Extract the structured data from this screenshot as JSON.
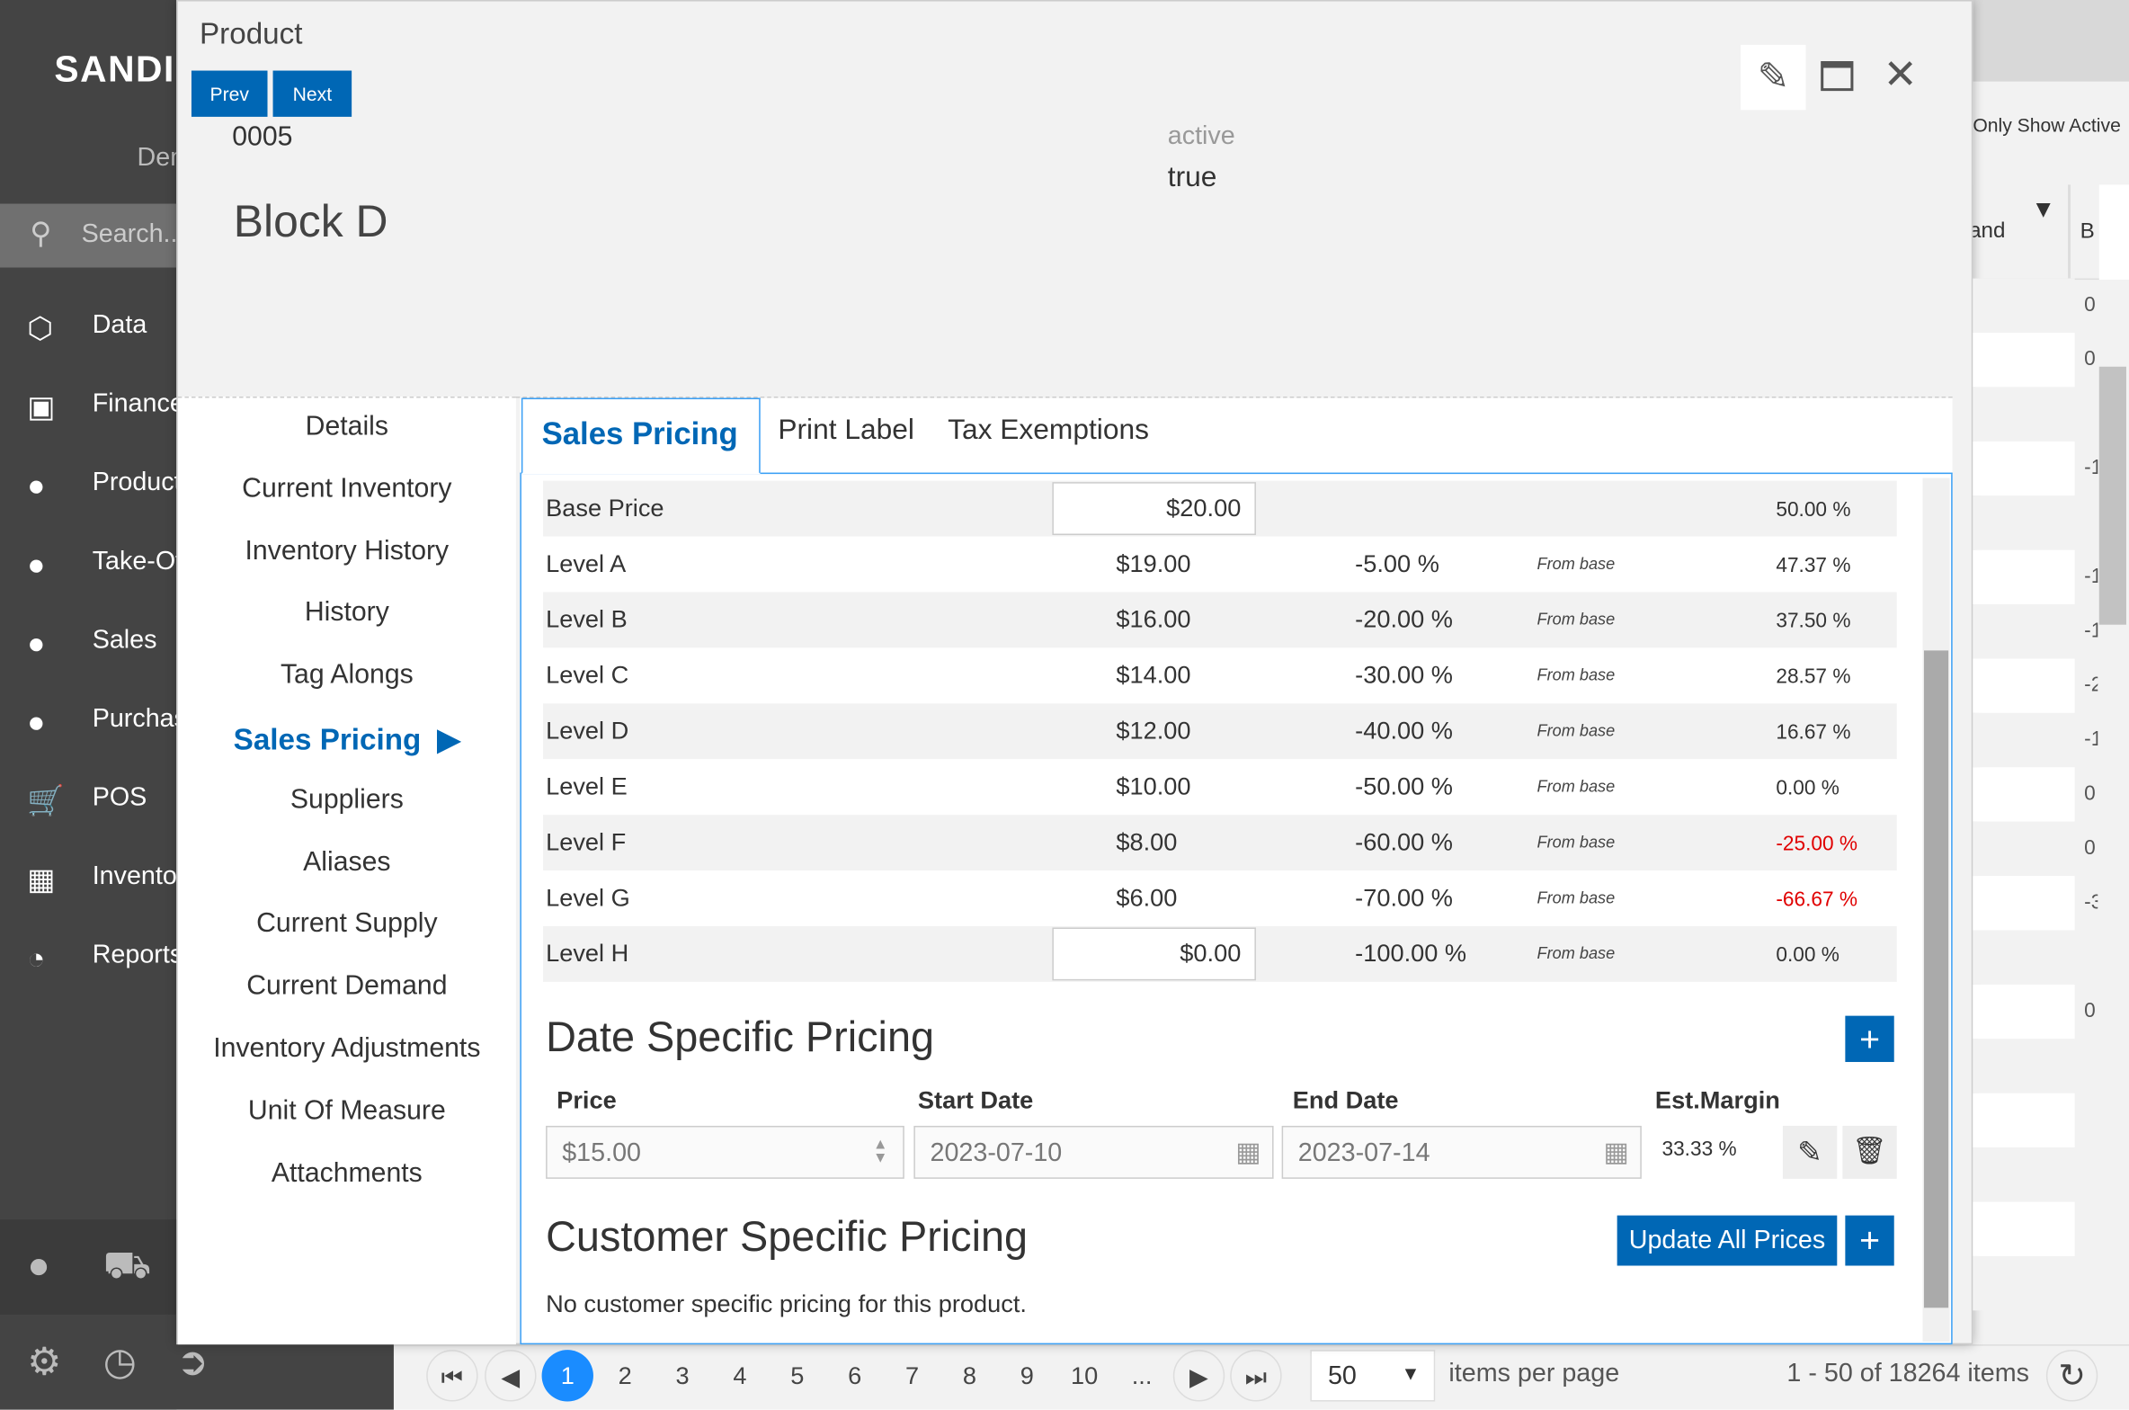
{
  "app": {
    "logo": "SANDI",
    "demo": "Demo",
    "search_placeholder": "Search...",
    "nav": [
      {
        "label": "Data",
        "icon": "cube-icon"
      },
      {
        "label": "Finance",
        "icon": "money-icon"
      },
      {
        "label": "Products",
        "icon": "users-icon"
      },
      {
        "label": "Take-Offs",
        "icon": "users-icon"
      },
      {
        "label": "Sales",
        "icon": "users-icon"
      },
      {
        "label": "Purchasing",
        "icon": "users-icon"
      },
      {
        "label": "POS",
        "icon": "cart-icon"
      },
      {
        "label": "Inventory",
        "icon": "boxes-icon"
      },
      {
        "label": "Reports",
        "icon": "pie-chart-icon"
      }
    ]
  },
  "background": {
    "only_show_active": "Only Show Active",
    "col_brand": "Brand",
    "col_b": "B",
    "values": [
      "0",
      "0",
      "",
      "-1",
      "",
      "-1",
      "-1",
      "-2",
      "-1",
      "0",
      "0",
      "-3",
      "",
      "0"
    ]
  },
  "pager": {
    "pages": [
      "1",
      "2",
      "3",
      "4",
      "5",
      "6",
      "7",
      "8",
      "9",
      "10",
      "..."
    ],
    "current": "1",
    "page_size": "50",
    "items_per_page": "items per page",
    "summary": "1 - 50 of 18264 items"
  },
  "modal": {
    "title": "Product",
    "prev": "Prev",
    "next": "Next",
    "code": "0005",
    "name": "Block D",
    "active_label": "active",
    "active_value": "true",
    "side_nav": [
      "Details",
      "Current Inventory",
      "Inventory History",
      "History",
      "Tag Alongs",
      "Sales Pricing",
      "Suppliers",
      "Aliases",
      "Current Supply",
      "Current Demand",
      "Inventory Adjustments",
      "Unit Of Measure",
      "Attachments"
    ],
    "side_nav_active": "Sales Pricing",
    "tabs": [
      "Sales Pricing",
      "Print Label",
      "Tax Exemptions"
    ],
    "pricing": [
      {
        "level": "Base Price",
        "price": "$20.00",
        "pct": "",
        "from": "",
        "margin": "50.00 %",
        "editable": true,
        "neg": false
      },
      {
        "level": "Level A",
        "price": "$19.00",
        "pct": "-5.00 %",
        "from": "From base",
        "margin": "47.37 %",
        "neg": false
      },
      {
        "level": "Level B",
        "price": "$16.00",
        "pct": "-20.00 %",
        "from": "From base",
        "margin": "37.50 %",
        "neg": false
      },
      {
        "level": "Level C",
        "price": "$14.00",
        "pct": "-30.00 %",
        "from": "From base",
        "margin": "28.57 %",
        "neg": false
      },
      {
        "level": "Level D",
        "price": "$12.00",
        "pct": "-40.00 %",
        "from": "From base",
        "margin": "16.67 %",
        "neg": false
      },
      {
        "level": "Level E",
        "price": "$10.00",
        "pct": "-50.00 %",
        "from": "From base",
        "margin": "0.00 %",
        "neg": false
      },
      {
        "level": "Level F",
        "price": "$8.00",
        "pct": "-60.00 %",
        "from": "From base",
        "margin": "-25.00 %",
        "neg": true
      },
      {
        "level": "Level G",
        "price": "$6.00",
        "pct": "-70.00 %",
        "from": "From base",
        "margin": "-66.67 %",
        "neg": true
      },
      {
        "level": "Level H",
        "price": "$0.00",
        "pct": "-100.00 %",
        "from": "From base",
        "margin": "0.00 %",
        "editable": true,
        "neg": false
      }
    ],
    "date_specific": {
      "title": "Date Specific Pricing",
      "headers": [
        "Price",
        "Start Date",
        "End Date",
        "Est.Margin"
      ],
      "price": "$15.00",
      "start": "2023-07-10",
      "end": "2023-07-14",
      "margin": "33.33 %"
    },
    "customer_specific": {
      "title": "Customer Specific Pricing",
      "update_all": "Update All Prices",
      "empty": "No customer specific pricing for this product."
    },
    "colors": {
      "accent": "#0067b5",
      "negative": "#e00000",
      "border": "#3a9ff5"
    }
  }
}
